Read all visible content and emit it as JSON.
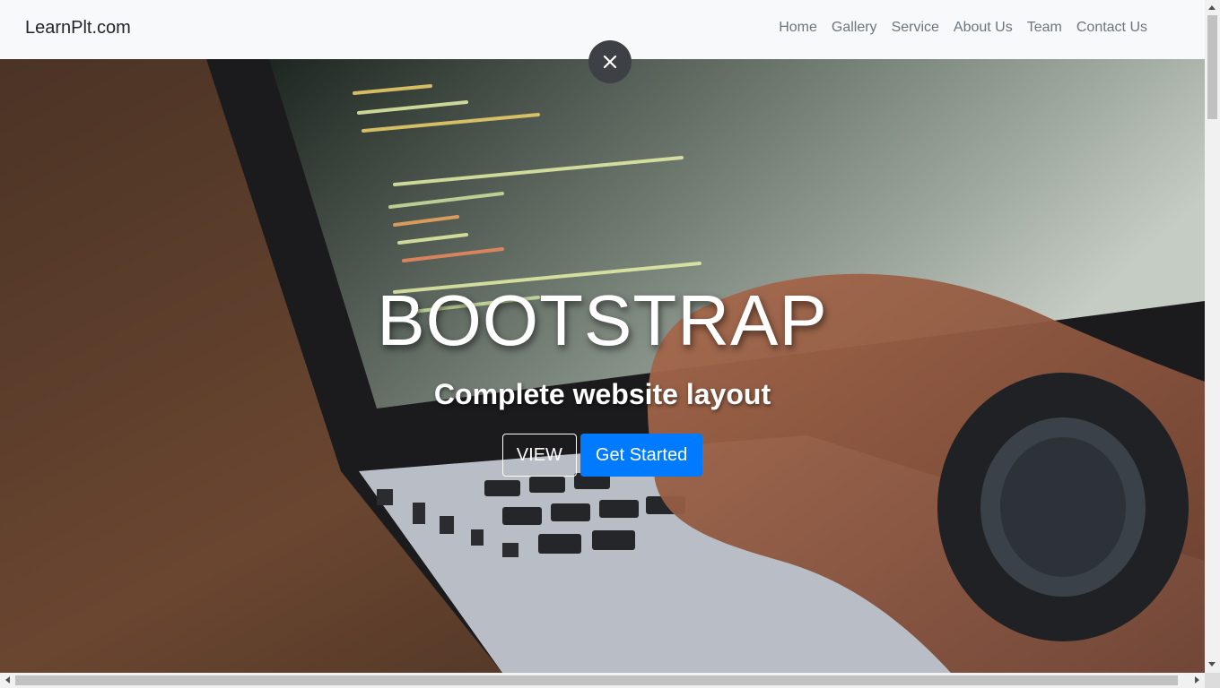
{
  "navbar": {
    "brand": "LearnPlt.com",
    "links": [
      "Home",
      "Gallery",
      "Service",
      "About Us",
      "Team",
      "Contact Us"
    ]
  },
  "hero": {
    "title": "BOOTSTRAP",
    "subtitle": "Complete website layout",
    "view_button": "VIEW",
    "primary_button": "Get Started",
    "primary_color": "#007bff"
  },
  "overlay": {
    "close_icon": "close-icon"
  }
}
